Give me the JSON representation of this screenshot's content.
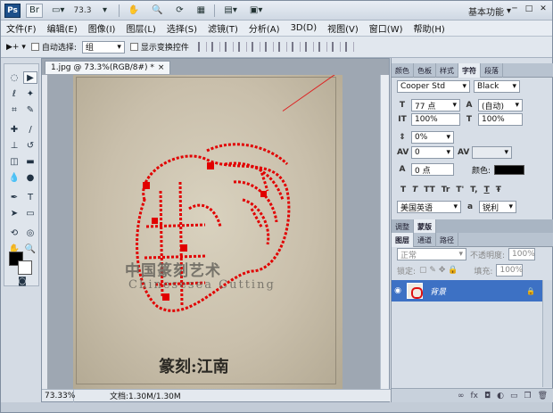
{
  "titlebar": {
    "logo": "Ps",
    "zoom": "73.3",
    "workspace": "基本功能"
  },
  "menubar": {
    "items": [
      "文件(F)",
      "编辑(E)",
      "图像(I)",
      "图层(L)",
      "选择(S)",
      "滤镜(T)",
      "分析(A)",
      "3D(D)",
      "视图(V)",
      "窗口(W)",
      "帮助(H)"
    ]
  },
  "options": {
    "auto_select_label": "自动选择:",
    "auto_select_value": "组",
    "show_transform_label": "显示变换控件"
  },
  "document": {
    "tab_title": "1.jpg @ 73.3%(RGB/8#) *",
    "canvas": {
      "brand_cn": "中国篆刻艺术",
      "brand_en": "Chinesesea Cutting",
      "title_cn": "篆刻:江南"
    },
    "status": {
      "zoom": "73.33%",
      "doc_size": "文档:1.30M/1.30M"
    }
  },
  "char_panel": {
    "tabs": [
      "颜色",
      "色板",
      "样式",
      "字符",
      "段落"
    ],
    "font_family": "Cooper Std",
    "font_style": "Black",
    "size": "77 点",
    "leading": "(自动)",
    "vscale": "100%",
    "hscale": "100%",
    "baseline_shift": "0%",
    "kerning": "0",
    "tracking": "",
    "shift": "0 点",
    "color_label": "颜色:",
    "language": "美国英语",
    "antialias": "锐利",
    "format_buttons": [
      "T",
      "T",
      "TT",
      "Tr",
      "T'",
      "T,",
      "T",
      "Ŧ"
    ]
  },
  "layers_panel": {
    "top_tabs": [
      "调整",
      "蒙版"
    ],
    "tabs": [
      "图层",
      "通道",
      "路径"
    ],
    "blend_mode": "正常",
    "opacity_label": "不透明度:",
    "opacity": "100%",
    "lock_label": "锁定:",
    "fill_label": "填充:",
    "fill": "100%",
    "layers": [
      {
        "name": "背景",
        "locked": true
      }
    ]
  }
}
